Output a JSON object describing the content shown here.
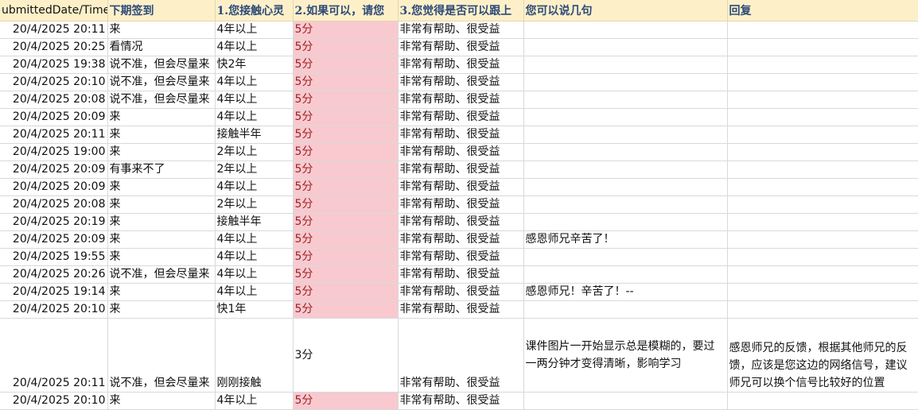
{
  "headers": [
    "ubmittedDate/Time",
    "下期签到",
    "1.您接触心灵",
    "2.如果可以，请您",
    "3.您觉得是否可以跟上",
    "您可以说几句",
    "回复"
  ],
  "rows": [
    {
      "date": "20/4/2025 20:11",
      "attend": "来",
      "years": "4年以上",
      "score": "5分",
      "help": "非常有帮助、很受益",
      "comment": "",
      "reply": ""
    },
    {
      "date": "20/4/2025 20:25",
      "attend": "看情况",
      "years": "4年以上",
      "score": "5分",
      "help": "非常有帮助、很受益",
      "comment": "",
      "reply": ""
    },
    {
      "date": "20/4/2025 19:38",
      "attend": "说不准，但会尽量来",
      "years": "快2年",
      "score": "5分",
      "help": "非常有帮助、很受益",
      "comment": "",
      "reply": ""
    },
    {
      "date": "20/4/2025 20:10",
      "attend": "说不准，但会尽量来",
      "years": "4年以上",
      "score": "5分",
      "help": "非常有帮助、很受益",
      "comment": "",
      "reply": ""
    },
    {
      "date": "20/4/2025 20:08",
      "attend": "说不准，但会尽量来",
      "years": "4年以上",
      "score": "5分",
      "help": "非常有帮助、很受益",
      "comment": "",
      "reply": ""
    },
    {
      "date": "20/4/2025 20:09",
      "attend": "来",
      "years": "4年以上",
      "score": "5分",
      "help": "非常有帮助、很受益",
      "comment": "",
      "reply": ""
    },
    {
      "date": "20/4/2025 20:11",
      "attend": "来",
      "years": "接触半年",
      "score": "5分",
      "help": "非常有帮助、很受益",
      "comment": "",
      "reply": ""
    },
    {
      "date": "20/4/2025 19:00",
      "attend": "来",
      "years": "2年以上",
      "score": "5分",
      "help": "非常有帮助、很受益",
      "comment": "",
      "reply": ""
    },
    {
      "date": "20/4/2025 20:09",
      "attend": "有事来不了",
      "years": "2年以上",
      "score": "5分",
      "help": "非常有帮助、很受益",
      "comment": "",
      "reply": ""
    },
    {
      "date": "20/4/2025 20:09",
      "attend": "来",
      "years": "4年以上",
      "score": "5分",
      "help": "非常有帮助、很受益",
      "comment": "",
      "reply": ""
    },
    {
      "date": "20/4/2025 20:08",
      "attend": "来",
      "years": "2年以上",
      "score": "5分",
      "help": "非常有帮助、很受益",
      "comment": "",
      "reply": ""
    },
    {
      "date": "20/4/2025 20:19",
      "attend": "来",
      "years": "接触半年",
      "score": "5分",
      "help": "非常有帮助、很受益",
      "comment": "",
      "reply": ""
    },
    {
      "date": "20/4/2025 20:09",
      "attend": "来",
      "years": "4年以上",
      "score": "5分",
      "help": "非常有帮助、很受益",
      "comment": "感恩师兄辛苦了！",
      "reply": ""
    },
    {
      "date": "20/4/2025 19:55",
      "attend": "来",
      "years": "4年以上",
      "score": "5分",
      "help": "非常有帮助、很受益",
      "comment": "",
      "reply": ""
    },
    {
      "date": "20/4/2025 20:26",
      "attend": "说不准，但会尽量来",
      "years": "4年以上",
      "score": "5分",
      "help": "非常有帮助、很受益",
      "comment": "",
      "reply": ""
    },
    {
      "date": "20/4/2025 19:14",
      "attend": "来",
      "years": "4年以上",
      "score": "5分",
      "help": "非常有帮助、很受益",
      "comment": "感恩师兄！辛苦了！--",
      "reply": ""
    },
    {
      "date": "20/4/2025 20:10",
      "attend": "来",
      "years": "快1年",
      "score": "5分",
      "help": "非常有帮助、很受益",
      "comment": "",
      "reply": ""
    }
  ],
  "tall_row": {
    "date": "20/4/2025 20:11",
    "attend": "说不准，但会尽量来",
    "years": "刚刚接触",
    "score": "3分",
    "help": "非常有帮助、很受益",
    "comment": "课件图片一开始显示总是模糊的，要过一两分钟才变得清晰，影响学习",
    "reply": "感恩师兄的反馈，根据其他师兄的反馈，应该是您这边的网络信号，建议师兄可以换个信号比较好的位置"
  },
  "last_row": {
    "date": "20/4/2025 20:10",
    "attend": "来",
    "years": "4年以上",
    "score": "5分",
    "help": "非常有帮助、很受益",
    "comment": "",
    "reply": ""
  }
}
